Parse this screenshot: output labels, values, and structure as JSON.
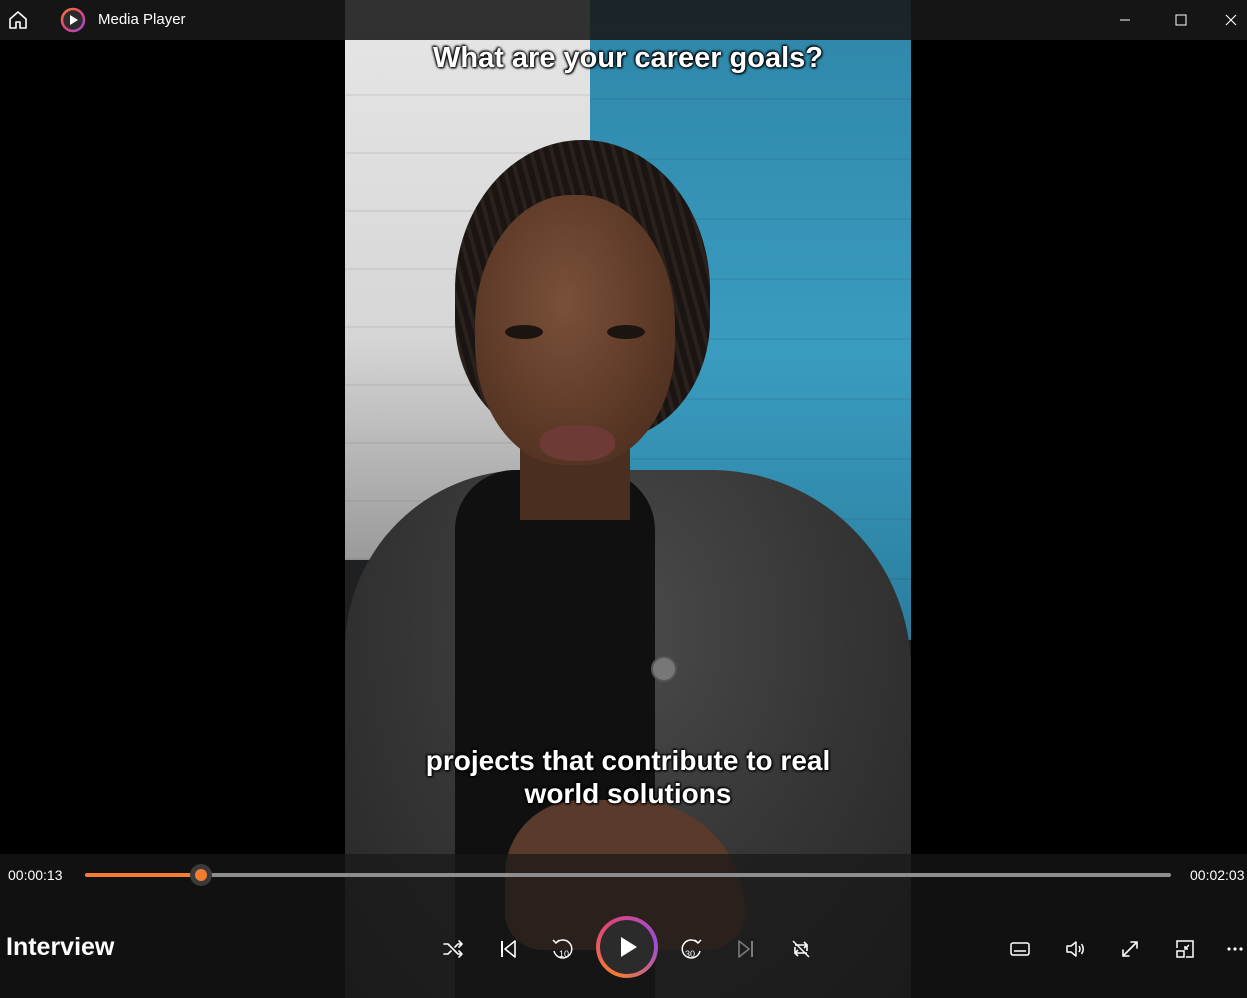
{
  "app": {
    "title": "Media Player",
    "icons": {
      "home": "home-icon",
      "logo": "media-player-logo-icon"
    },
    "window_controls": [
      "minimize-icon",
      "maximize-icon",
      "close-icon"
    ]
  },
  "video": {
    "caption_top": "What are your career goals?",
    "caption_bottom_line1": "projects that contribute to real",
    "caption_bottom_line2": "world solutions"
  },
  "playback": {
    "current_time": "00:00:13",
    "total_time": "00:02:03",
    "progress_fraction": 0.107,
    "accent_color": "#f47c31",
    "media_title": "Interview"
  },
  "transport": {
    "buttons": [
      "shuffle-icon",
      "previous-icon",
      "rewind-10-icon",
      "play-icon",
      "forward-30-icon",
      "next-icon",
      "repeat-icon"
    ],
    "rewind_label": "10",
    "forward_label": "30"
  },
  "right_controls": [
    "captions-icon",
    "volume-icon",
    "fullscreen-icon",
    "mini-player-icon",
    "more-icon"
  ]
}
